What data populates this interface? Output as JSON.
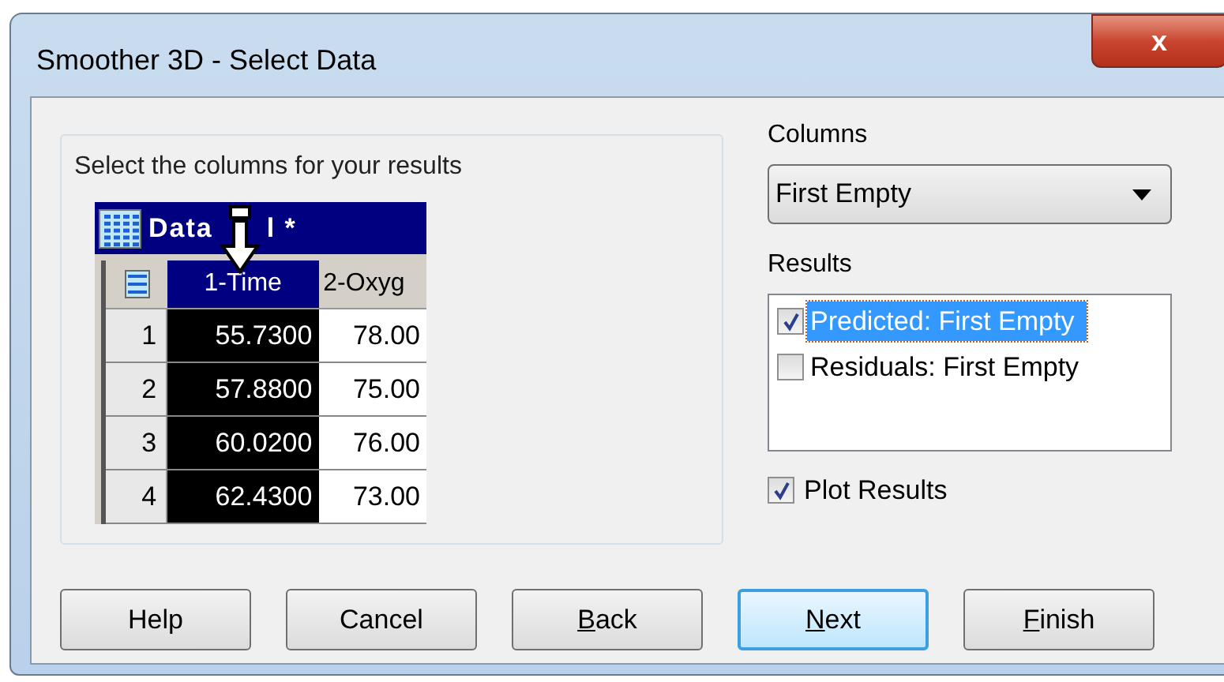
{
  "window": {
    "title": "Smoother 3D - Select Data",
    "close": "x"
  },
  "group": {
    "label": "Select the columns for your results"
  },
  "worksheet": {
    "title_start": "Data",
    "title_end": "l *",
    "columns": [
      {
        "label": "1-Time",
        "selected": true
      },
      {
        "label": "2-Oxyg",
        "selected": false
      }
    ],
    "rows": [
      {
        "index": "1",
        "cells": [
          "55.7300",
          "78.00"
        ]
      },
      {
        "index": "2",
        "cells": [
          "57.8800",
          "75.00"
        ]
      },
      {
        "index": "3",
        "cells": [
          "60.0200",
          "76.00"
        ]
      },
      {
        "index": "4",
        "cells": [
          "62.4300",
          "73.00"
        ]
      }
    ]
  },
  "columns": {
    "label": "Columns",
    "value": "First Empty"
  },
  "results": {
    "label": "Results",
    "items": [
      {
        "label": "Predicted: First Empty",
        "checked": true,
        "selected": true
      },
      {
        "label": "Residuals: First Empty",
        "checked": false,
        "selected": false
      }
    ]
  },
  "plot_results": {
    "label": "Plot Results",
    "checked": true
  },
  "buttons": [
    {
      "label": "Help",
      "underline_first": false,
      "default": false
    },
    {
      "label": "Cancel",
      "underline_first": false,
      "default": false
    },
    {
      "label": "Back",
      "underline_first": true,
      "default": false
    },
    {
      "label": "Next",
      "underline_first": true,
      "default": true
    },
    {
      "label": "Finish",
      "underline_first": true,
      "default": false
    }
  ]
}
